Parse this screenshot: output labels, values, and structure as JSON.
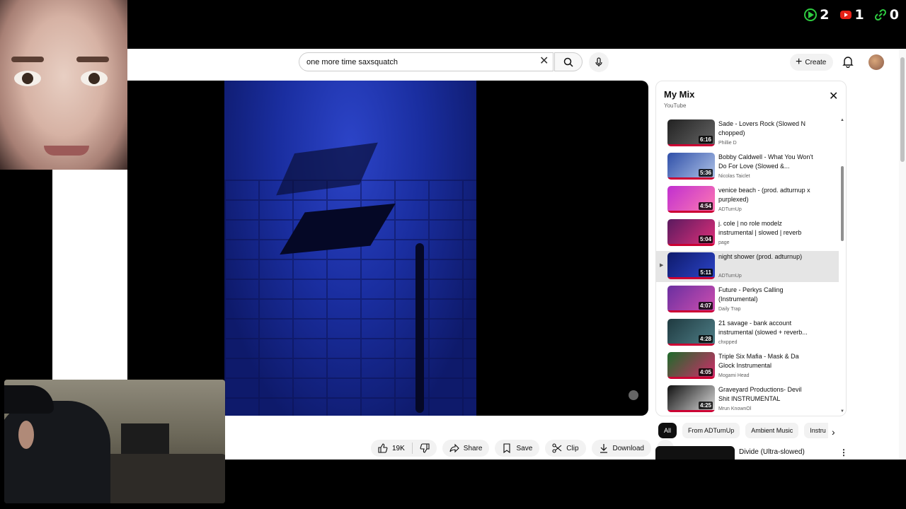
{
  "stream_stats": [
    {
      "icon": "play-triangle-icon",
      "color": "#2ecc40",
      "value": "2"
    },
    {
      "icon": "youtube-logo-icon",
      "color": "#e62117",
      "value": "1"
    },
    {
      "icon": "link-icon",
      "color": "#2ecc40",
      "value": "0"
    }
  ],
  "header": {
    "search_value": "one more time saxsquatch",
    "create_label": "Create"
  },
  "actions": {
    "like_count": "19K",
    "share_label": "Share",
    "save_label": "Save",
    "clip_label": "Clip",
    "download_label": "Download"
  },
  "mix": {
    "title": "My Mix",
    "subtitle": "YouTube",
    "items": [
      {
        "title": "Sade - Lovers Rock (Slowed N chopped)",
        "channel": "Phillie D",
        "duration": "6:16",
        "colors": [
          "#222",
          "#666"
        ],
        "active": false
      },
      {
        "title": "Bobby Caldwell - What You Won't Do For Love (Slowed &...",
        "channel": "Nicolas Taiclet",
        "duration": "5:36",
        "colors": [
          "#2f4fa8",
          "#b0c4e8"
        ],
        "active": false
      },
      {
        "title": "venice beach - (prod. adturnup x purplexed)",
        "channel": "ADTurnUp",
        "duration": "4:54",
        "colors": [
          "#c02fd0",
          "#ff7ab2"
        ],
        "active": false
      },
      {
        "title": "j. cole | no role modelz instrumental | slowed | reverb",
        "channel": "page",
        "duration": "5:04",
        "colors": [
          "#5a1a5f",
          "#e0307a"
        ],
        "active": false
      },
      {
        "title": "night shower (prod. adturnup)",
        "channel": "ADTurnUp",
        "duration": "5:11",
        "colors": [
          "#0e1a6b",
          "#2c44c8"
        ],
        "active": true
      },
      {
        "title": "Future - Perkys Calling (Instrumental)",
        "channel": "Daily Trap",
        "duration": "4:07",
        "colors": [
          "#6a2fa0",
          "#d04fb0"
        ],
        "active": false
      },
      {
        "title": "21 savage - bank account instrumental (slowed + reverb...",
        "channel": "chxpped",
        "duration": "4:28",
        "colors": [
          "#1f3a40",
          "#4f7f88"
        ],
        "active": false
      },
      {
        "title": "Triple Six Mafia - Mask & Da Glock Instrumental",
        "channel": "Mogami Head",
        "duration": "4:05",
        "colors": [
          "#1d6b2a",
          "#d62a6c"
        ],
        "active": false
      },
      {
        "title": "Graveyard Productions- Devil Shit INSTRUMENTAL",
        "channel": "Mrun KnownOl",
        "duration": "4:25",
        "colors": [
          "#111",
          "#ddd"
        ],
        "active": false
      }
    ]
  },
  "chips": [
    "All",
    "From ADTurnUp",
    "Ambient Music",
    "Instru"
  ],
  "recommendation": {
    "title": "Divide (Ultra-slowed)"
  }
}
